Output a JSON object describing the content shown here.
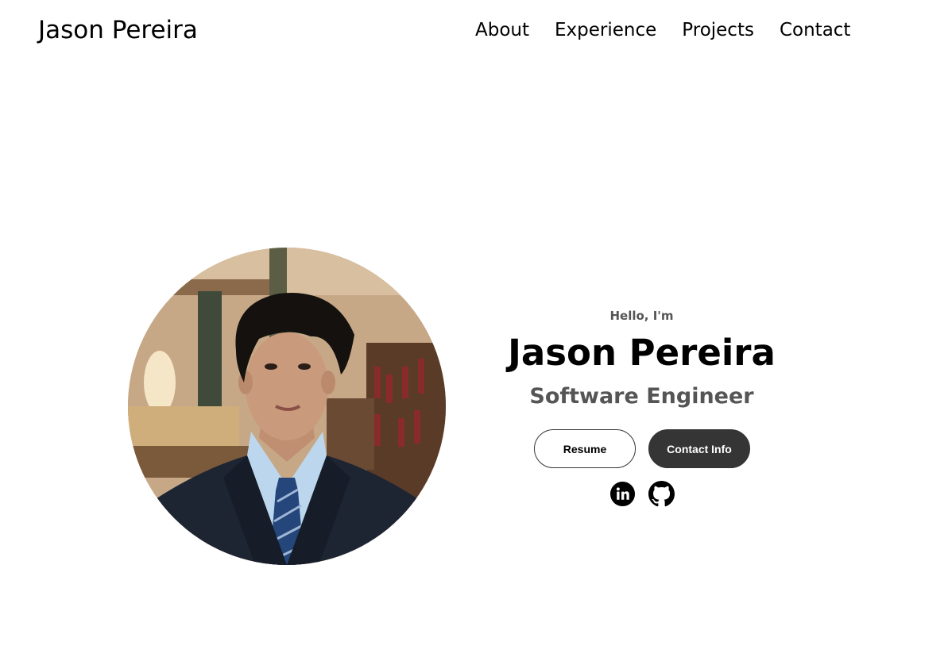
{
  "nav": {
    "logo": "Jason Pereira",
    "links": [
      "About",
      "Experience",
      "Projects",
      "Contact"
    ]
  },
  "hero": {
    "greeting": "Hello, I'm",
    "name": "Jason Pereira",
    "title": "Software Engineer",
    "buttons": {
      "resume": "Resume",
      "contact": "Contact Info"
    },
    "socials": {
      "linkedin_icon": "linkedin-icon",
      "github_icon": "github-icon"
    },
    "photo_alt": "Profile picture"
  },
  "colors": {
    "text": "#000000",
    "muted": "#555555",
    "button_dark": "#353535",
    "background": "#ffffff"
  }
}
